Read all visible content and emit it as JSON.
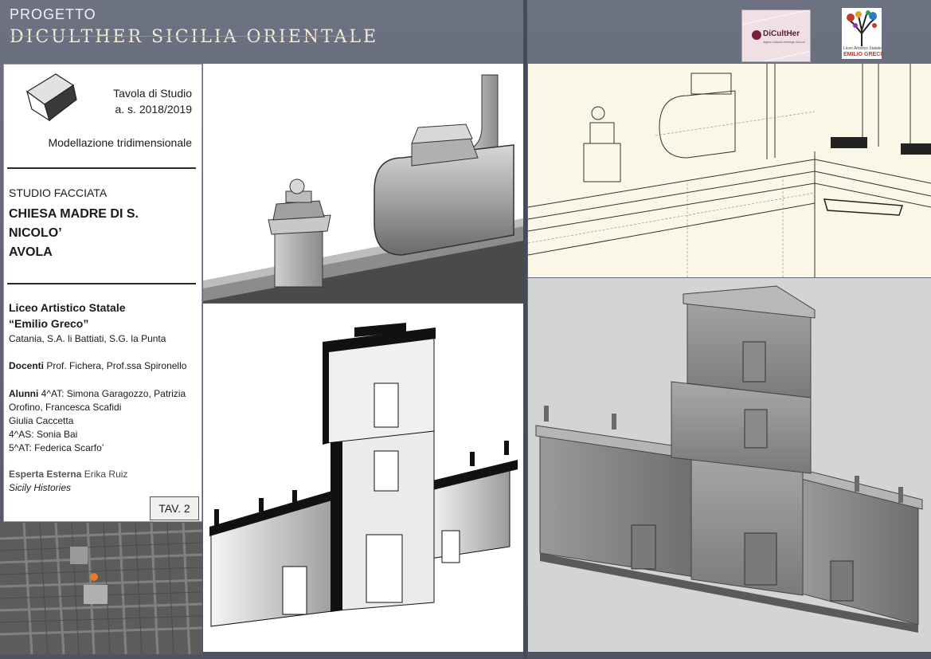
{
  "header": {
    "project_label": "PROGETTO",
    "project_title": "DICULTHER SICILIA ORIENTALE"
  },
  "logos": {
    "dicult_text": "DiCultHer",
    "dicult_sub": "digital cultural heritage school",
    "liceo_line1": "Liceo Artistico Statale",
    "liceo_line2": "EMILIO GRECO"
  },
  "info": {
    "tavola_title": "Tavola di Studio",
    "tavola_year": "a. s. 2018/2019",
    "modellazione": "Modellazione tridimensionale",
    "studio_label": "STUDIO FACCIATA",
    "chiesa_line1": "CHIESA MADRE DI S.",
    "chiesa_line2": "NICOLO’",
    "chiesa_line3": "AVOLA",
    "liceo_name": "Liceo Artistico Statale",
    "liceo_name2": "“Emilio Greco”",
    "liceo_location": "Catania, S.A. li Battiati, S.G. la Punta",
    "docenti_label": "Docenti",
    "docenti_value": " Prof. Fichera, Prof.ssa Spironello",
    "alunni_label": "Alunni",
    "alunni_line1": " 4^AT: Simona Garagozzo, Patrizia",
    "alunni_line2": "Orofino, Francesca Scafidi",
    "alunni_line3": "Giulia Caccetta",
    "alunni_line4": "4^AS: Sonia Bai",
    "alunni_line5": "5^AT: Federica Scarfo’",
    "esperta_label": "Esperta Esterna",
    "esperta_value": " Erika Ruiz",
    "esperta_org": "Sicily Histories",
    "tav_number": "TAV. 2"
  },
  "icons": {
    "cube": "cube-icon",
    "map": "city-map-thumbnail"
  },
  "colors": {
    "background": "#5d6372",
    "accent_line": "#c9892e",
    "map_marker": "#e8782a"
  }
}
